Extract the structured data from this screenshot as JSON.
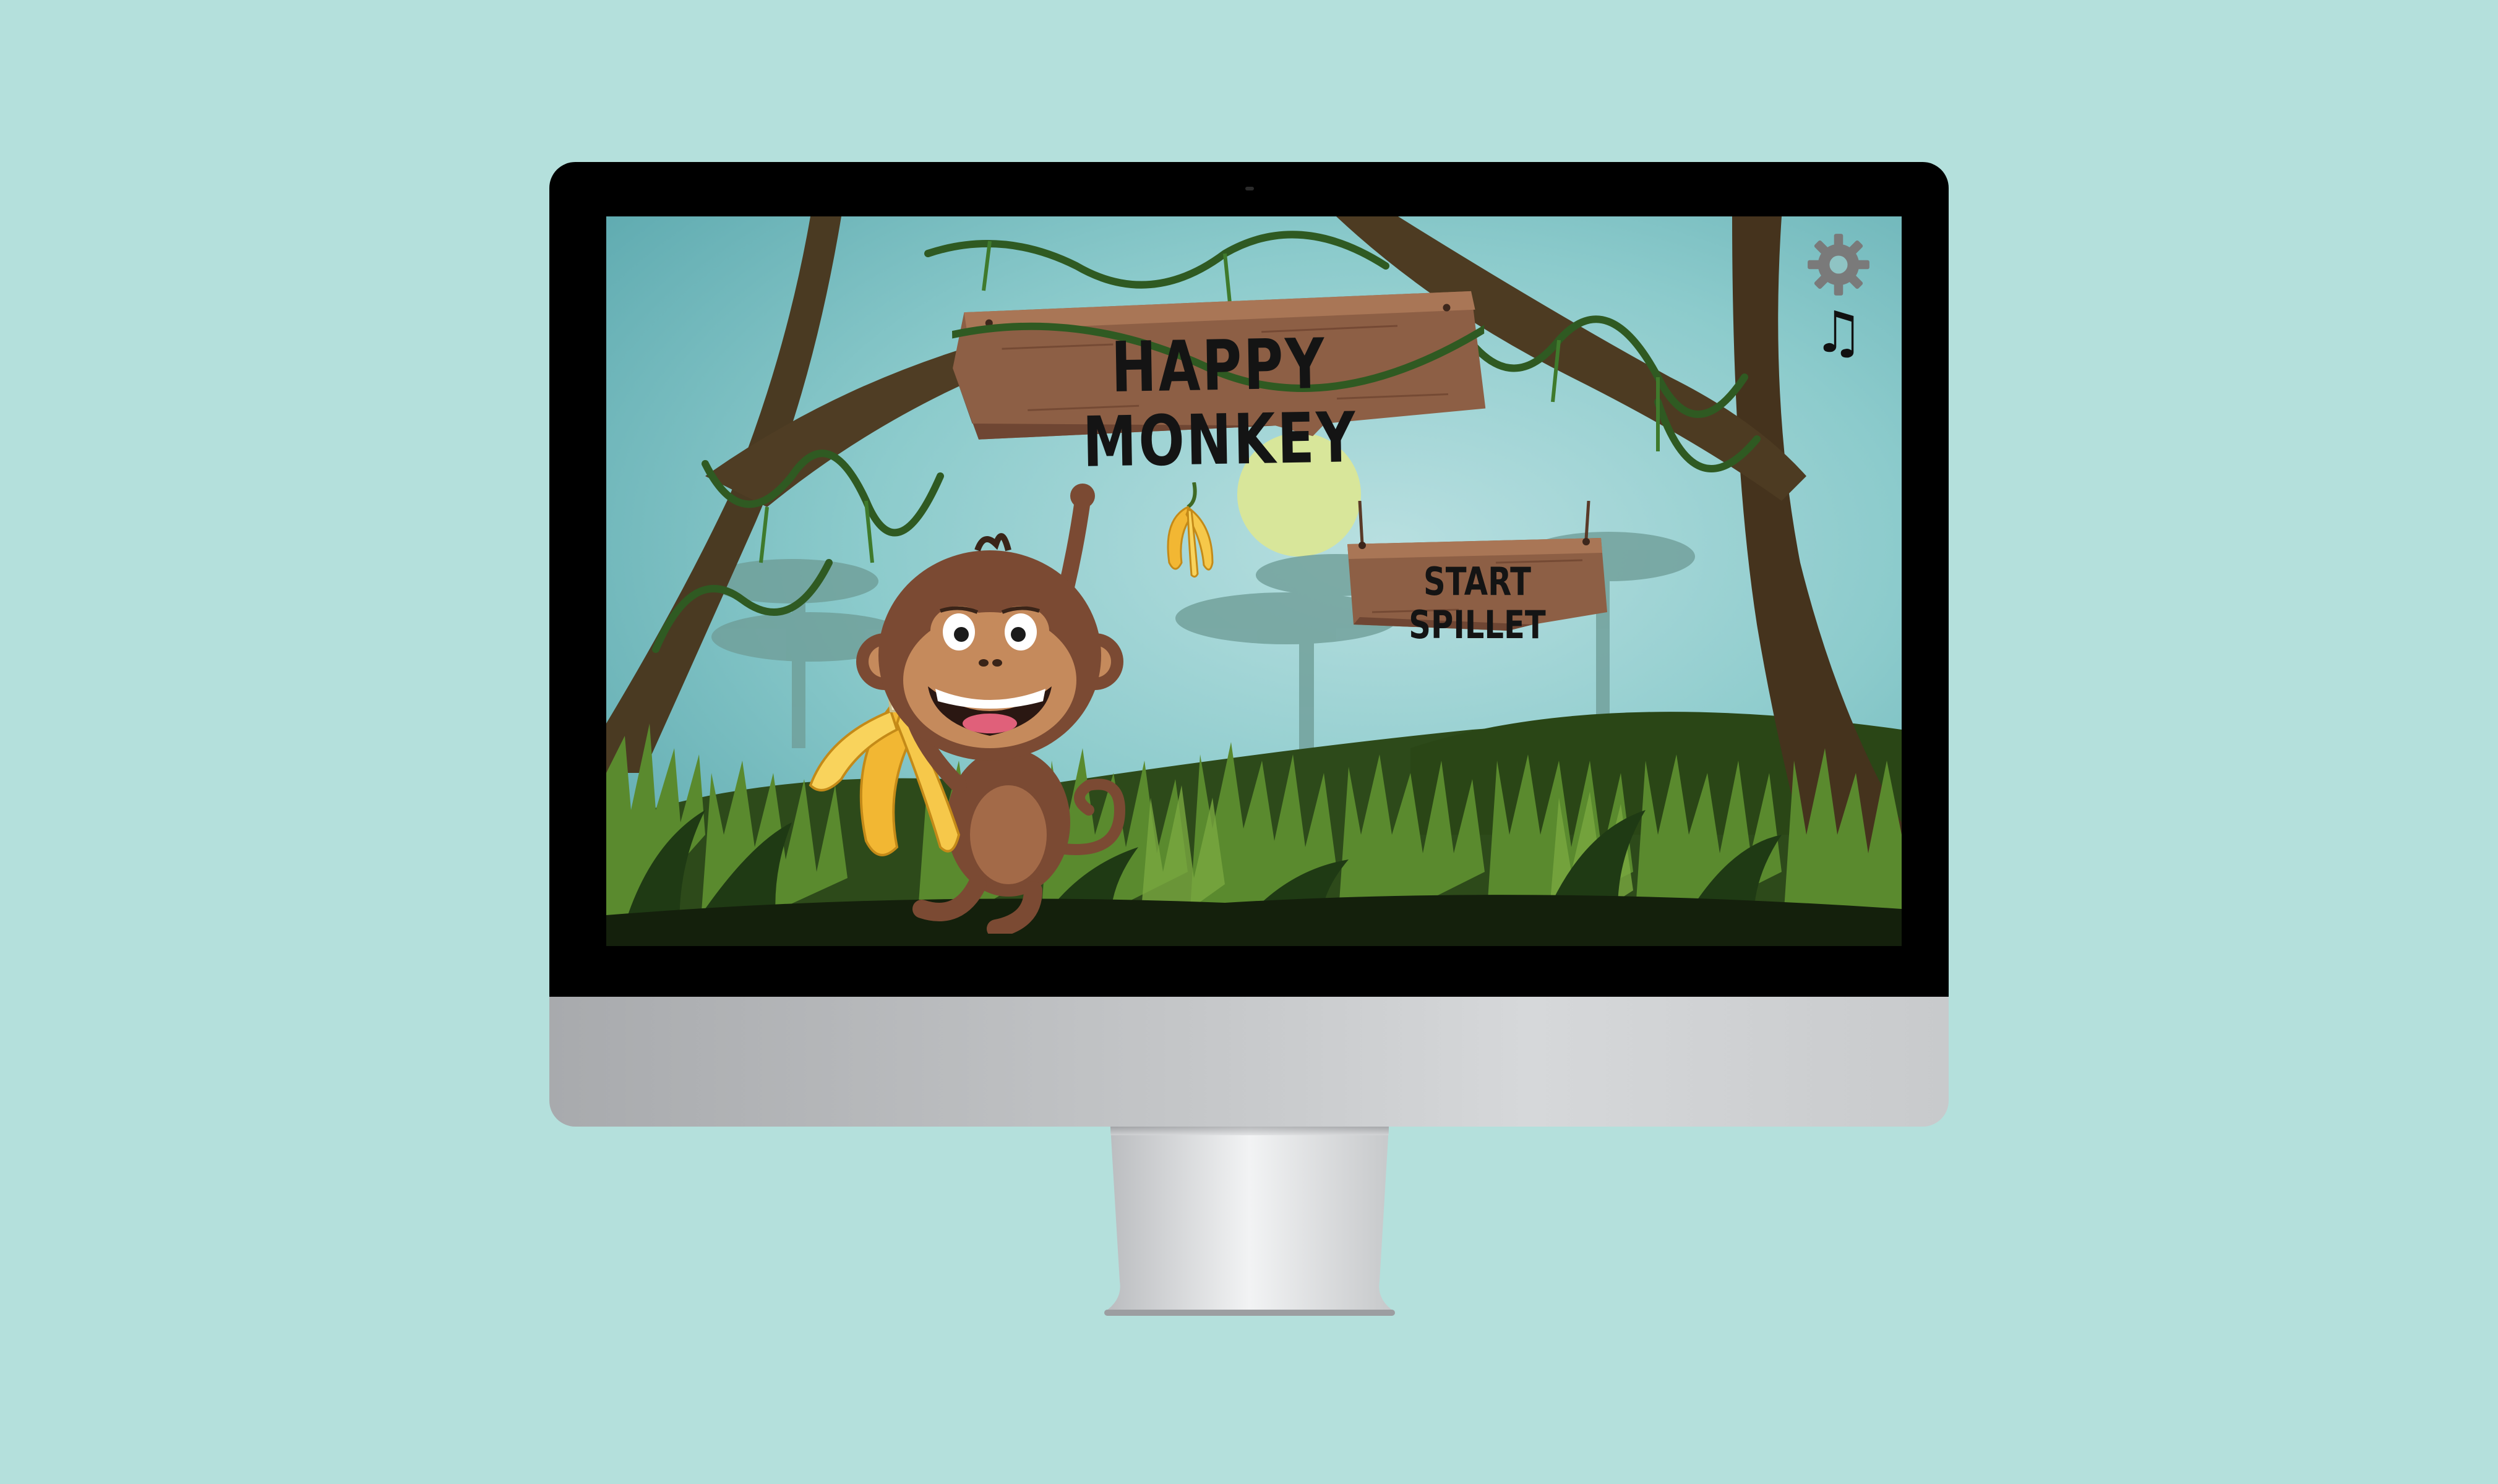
{
  "game": {
    "title": "HAPPY MONKEY",
    "start_button_label": "START SPILLET",
    "settings_icon": "gear-icon",
    "music_icon": "music-note-icon",
    "music_glyph": "♫"
  },
  "colors": {
    "background": "#b4e0dc",
    "sky": "#7fc4c8",
    "sun": "#d8e69a",
    "wood": "#8d5f45",
    "grass": "#5a8a2e",
    "monkey_brown": "#7b4a33"
  }
}
